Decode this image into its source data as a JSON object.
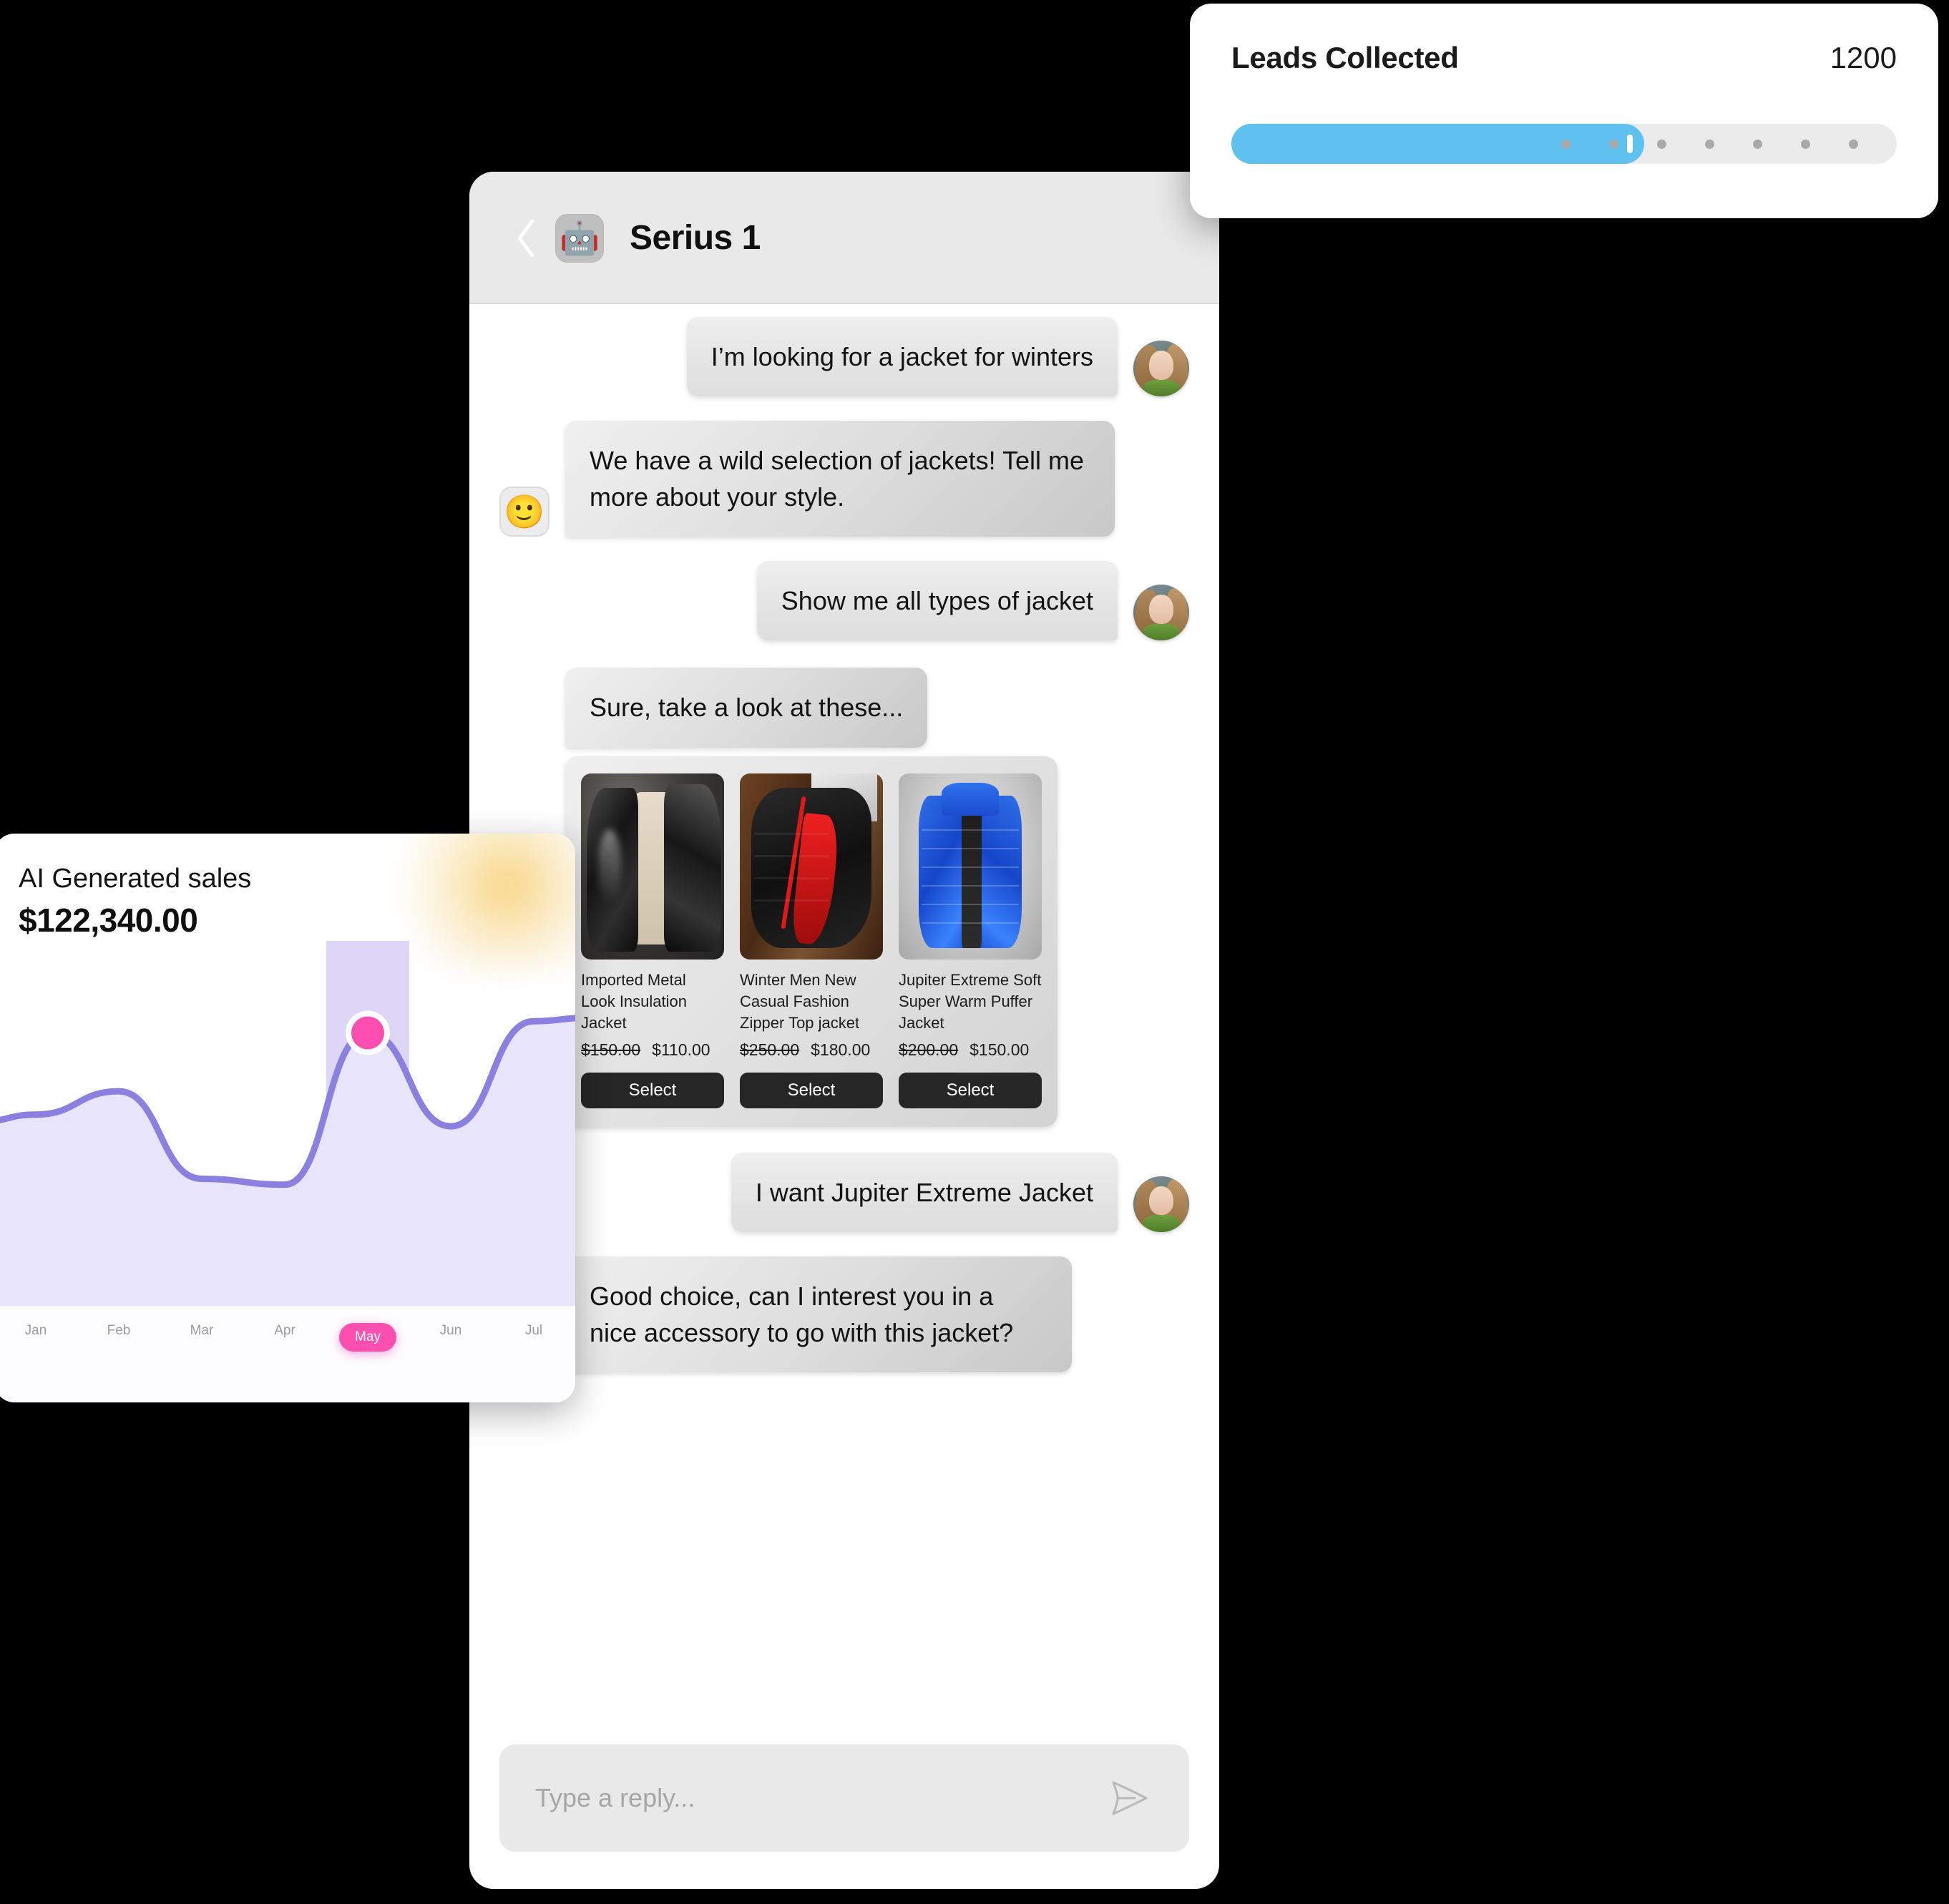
{
  "leads": {
    "label": "Leads Collected",
    "value": "1200",
    "progress_percent": 62,
    "dots": 7,
    "fill_color": "#5ec1f0",
    "track_color": "#ebebeb"
  },
  "chat": {
    "title": "Serius 1",
    "bot_icon": "robot-icon",
    "back_icon": "chevron-left-icon",
    "bot_avatar_emoji": "🙂",
    "messages": [
      {
        "from": "user",
        "text": "I’m looking for a jacket for winters"
      },
      {
        "from": "bot",
        "text": "We have a wild selection of jackets! Tell me more about your style."
      },
      {
        "from": "user",
        "text": "Show me all types of jacket"
      },
      {
        "from": "bot",
        "text": "Sure, take a look at these..."
      },
      {
        "from": "user",
        "text": "I want Jupiter Extreme Jacket"
      },
      {
        "from": "bot",
        "text": "Good choice, can I interest you in a nice accessory to go with this jacket?"
      }
    ],
    "products": [
      {
        "name": "Imported Metal Look Insulation Jacket",
        "old_price": "$150.00",
        "price": "$110.00",
        "button": "Select",
        "image": "black-glossy-puffer-jacket-on-model"
      },
      {
        "name": "Winter Men New Casual Fashion Zipper Top jacket",
        "old_price": "$250.00",
        "price": "$180.00",
        "button": "Select",
        "image": "black-puffer-jacket-red-lining-on-wood"
      },
      {
        "name": "Jupiter Extreme Soft Super Warm Puffer Jacket",
        "old_price": "$200.00",
        "price": "$150.00",
        "button": "Select",
        "image": "blue-puffer-jacket-product-shot"
      }
    ],
    "composer": {
      "placeholder": "Type a reply...",
      "value": "",
      "send_icon": "send-arrow-icon"
    }
  },
  "chart_data": {
    "type": "area",
    "title": "AI Generated sales",
    "value_label": "$122,340.00",
    "categories": [
      "Jan",
      "Feb",
      "Mar",
      "Apr",
      "May",
      "Jun",
      "Jul"
    ],
    "values": [
      58,
      66,
      36,
      34,
      86,
      54,
      90
    ],
    "selected_category": "May",
    "highlight_point": {
      "category": "May",
      "value": 86
    },
    "xlabel": "",
    "ylabel": "",
    "ylim": [
      0,
      100
    ],
    "grid": false,
    "legend": "none",
    "line_color": "#8b7fe0",
    "fill_color": "#e8e4fb",
    "accent_color": "#fc4fb0",
    "highlight_band_color": "#ddd6f7"
  }
}
